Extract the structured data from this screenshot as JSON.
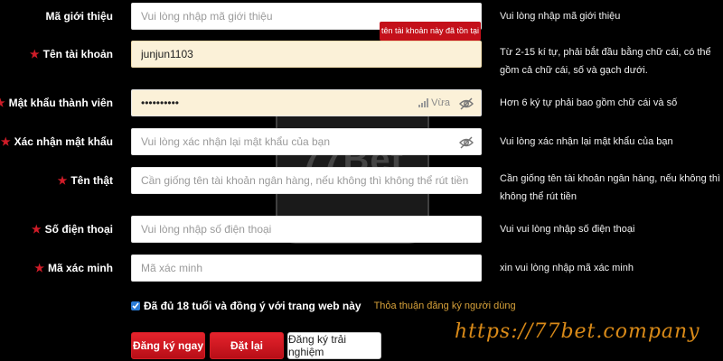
{
  "watermark": {
    "logo": "77Bet",
    "site": "77BET.COMPANY"
  },
  "fields": {
    "referral": {
      "label": "Mã giới thiệu",
      "placeholder": "Vui lòng nhập mã giới thiệu",
      "value": "",
      "hint": "Vui lòng nhập mã giới thiệu",
      "tooltip": "tên tài khoản này đã tồn tại"
    },
    "username": {
      "label": "Tên tài khoản",
      "placeholder": "",
      "value": "junjun1103",
      "hint": "Từ 2-15 kí tự, phải bắt đầu bằng chữ cái, có thể gồm cả chữ cái, số và gạch dưới."
    },
    "password": {
      "label": "Mật khẩu thành viên",
      "placeholder": "",
      "value": "••••••••••",
      "strength": "Vừa",
      "hint": "Hơn 6 ký tự phải bao gồm chữ cái và số"
    },
    "confirm": {
      "label": "Xác nhận mật khẩu",
      "placeholder": "Vui lòng xác nhận lại mật khẩu của bạn",
      "value": "",
      "hint": "Vui lòng xác nhận lại mật khẩu của bạn"
    },
    "realname": {
      "label": "Tên thật",
      "placeholder": "Cần giống tên tài khoản ngân hàng, nếu không thì không thể rút tiền",
      "value": "",
      "hint": "Cần giống tên tài khoản ngân hàng, nếu không thì không thể rút tiền"
    },
    "phone": {
      "label": "Số điện thoại",
      "placeholder": "Vui lòng nhập số điện thoại",
      "value": "",
      "hint": "Vui vui lòng nhập số điện thoại"
    },
    "captcha": {
      "label": "Mã xác minh",
      "placeholder": "Mã xác minh",
      "value": "",
      "hint": "xin vui lòng nhập mã xác minh"
    }
  },
  "agreement": {
    "checked": true,
    "text": "Đã đủ 18 tuổi và đồng ý với trang web này",
    "link": "Thỏa thuận đăng ký người dùng"
  },
  "buttons": {
    "register": "Đăng ký ngay",
    "reset": "Đặt lại",
    "trial": "Đăng ký trải nghiệm"
  },
  "site_url": "https://77bet.company",
  "colors": {
    "accent_red": "#d01c28",
    "link_gold": "#d8a23a",
    "url_orange": "#d98a18",
    "background": "#000000"
  }
}
